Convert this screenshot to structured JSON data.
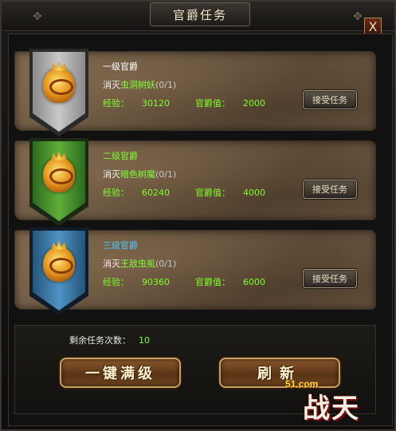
{
  "window": {
    "title": "官爵任务",
    "close_label": "X"
  },
  "quests": [
    {
      "title": "一级官爵",
      "title_color": "#ffffff",
      "banner_color": "#9a9a9a",
      "task_prefix": "消灭",
      "target": "虫洞树妖",
      "progress": "(0/1)",
      "exp_label": "经验：",
      "exp_value": "30120",
      "rank_label": "官爵值：",
      "rank_value": "2000",
      "button": "接受任务"
    },
    {
      "title": "二级官爵",
      "title_color": "#7cff2c",
      "banner_color": "#3f8a2a",
      "task_prefix": "消灭",
      "target": "暗色树魔",
      "progress": "(0/1)",
      "exp_label": "经验：",
      "exp_value": "60240",
      "rank_label": "官爵值：",
      "rank_value": "4000",
      "button": "接受任务"
    },
    {
      "title": "三级官爵",
      "title_color": "#4fc8ff",
      "banner_color": "#2f6d9a",
      "task_prefix": "消灭",
      "target": "王敌虫虱",
      "progress": "(0/1)",
      "exp_label": "经验：",
      "exp_value": "90360",
      "rank_label": "官爵值：",
      "rank_value": "6000",
      "button": "接受任务"
    }
  ],
  "footer": {
    "remaining_label": "剩余任务次数：",
    "remaining_value": "10",
    "max_button": "一键满级",
    "refresh_button": "刷新"
  },
  "brand": {
    "site": "51.com",
    "logo": "战天"
  }
}
